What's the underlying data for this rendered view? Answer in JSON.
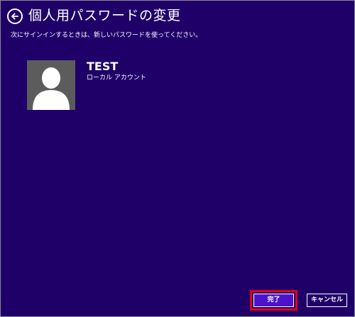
{
  "header": {
    "back_icon": "arrow-left-circle-icon",
    "title": "個人用パスワードの変更"
  },
  "instruction": "次にサインインするときは、新しいパスワードを使ってください。",
  "user": {
    "avatar_icon": "user-silhouette-icon",
    "name": "TEST",
    "account_type": "ローカル アカウント"
  },
  "buttons": {
    "finish_label": "完了",
    "cancel_label": "キャンセル"
  },
  "colors": {
    "background": "#1f0068",
    "primary_button": "#4d13cc",
    "highlight": "#e0001a",
    "avatar_bg": "#5c5c5c"
  }
}
